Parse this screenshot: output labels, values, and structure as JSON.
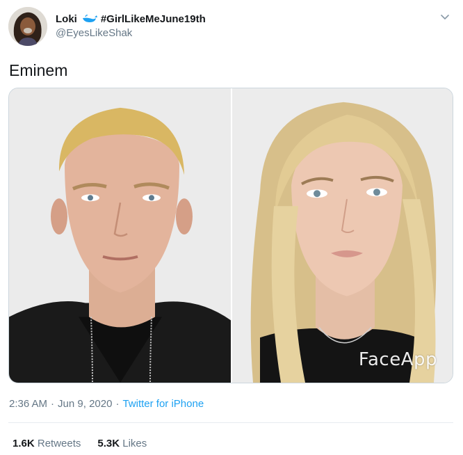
{
  "user": {
    "display_name": "Loki",
    "hashtag": "#GirlLikeMeJune19th",
    "handle": "@EyesLikeShak",
    "icons": [
      "avatar",
      "whale-icon",
      "chevron-down-icon"
    ]
  },
  "tweet": {
    "text": "Eminem",
    "media_watermark": "FaceApp"
  },
  "meta": {
    "time": "2:36 AM",
    "separator": "·",
    "date": "Jun 9, 2020",
    "source": "Twitter for iPhone"
  },
  "stats": {
    "retweets_count": "1.6K",
    "retweets_label": "Retweets",
    "likes_count": "5.3K",
    "likes_label": "Likes"
  },
  "colors": {
    "text": "#14171a",
    "secondary": "#657786",
    "link": "#1da1f2",
    "divider": "#e6ecf0"
  }
}
